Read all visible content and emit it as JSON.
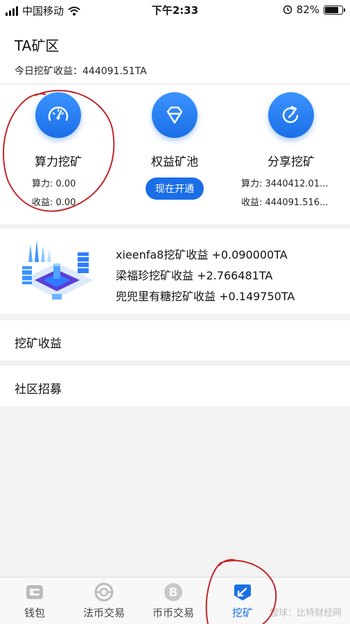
{
  "status_bar": {
    "carrier": "中国移动",
    "time": "下午2:33",
    "battery_text": "82%",
    "battery_level": 0.82,
    "icons": [
      "signal-icon",
      "wifi-icon",
      "alarm-icon",
      "battery-icon"
    ]
  },
  "header": {
    "title": "TA矿区",
    "today_label": "今日挖矿收益：",
    "today_value": "444091.51TA"
  },
  "mining": {
    "columns": [
      {
        "title": "算力挖矿",
        "icon": "gauge-icon",
        "line1": "算力: 0.00",
        "line2": "收益: 0.00"
      },
      {
        "title": "权益矿池",
        "icon": "diamond-icon",
        "button": "现在开通"
      },
      {
        "title": "分享挖矿",
        "icon": "share-arrow-icon",
        "line1": "算力: 3440412.01...",
        "line2": "收益: 444091.516..."
      }
    ]
  },
  "feed": {
    "illustration": "mining-server-illustration",
    "items": [
      "xieenfa8挖矿收益 +0.090000TA",
      "梁福珍挖矿收益 +2.766481TA",
      "兜兜里有糖挖矿收益 +0.149750TA"
    ]
  },
  "rows": [
    {
      "label": "挖矿收益"
    },
    {
      "label": "社区招募"
    }
  ],
  "tabbar": {
    "tabs": [
      {
        "label": "钱包",
        "icon": "wallet-icon",
        "active": false
      },
      {
        "label": "法币交易",
        "icon": "fiat-exchange-icon",
        "active": false
      },
      {
        "label": "币币交易",
        "icon": "bitcoin-icon",
        "active": false
      },
      {
        "label": "挖矿",
        "icon": "mining-icon",
        "active": true
      }
    ],
    "watermark": "雪球：比特财经网"
  },
  "colors": {
    "accent": "#1a6fe6",
    "annotation": "#c0262a",
    "background": "#f2f2f2"
  }
}
